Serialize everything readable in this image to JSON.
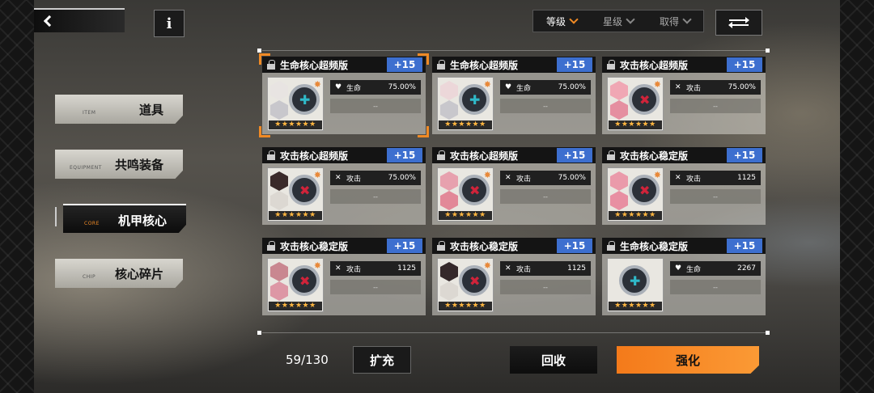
{
  "top": {
    "back_icon": "chevron-left-icon",
    "info_label": "i"
  },
  "sort": {
    "options": [
      {
        "label": "等级",
        "active": true
      },
      {
        "label": "星级",
        "active": false
      },
      {
        "label": "取得",
        "active": false
      }
    ],
    "swap_icon": "swap-arrows-icon"
  },
  "tabs": [
    {
      "en": "ITEM",
      "zh": "道具",
      "active": false
    },
    {
      "en": "EQUIPMENT",
      "zh": "共鸣装备",
      "active": false
    },
    {
      "en": "CORE",
      "zh": "机甲核心",
      "active": true
    },
    {
      "en": "CHIP",
      "zh": "核心碎片",
      "active": false
    }
  ],
  "cards": [
    {
      "name": "生命核心超频版",
      "level": "+15",
      "stat": "生命",
      "value": "75.00%",
      "empty": "--",
      "kind": "life",
      "selected": true,
      "stars": "★★★★★★",
      "hexes": [
        "#e8e4e2",
        "#c8c7cc"
      ]
    },
    {
      "name": "生命核心超频版",
      "level": "+15",
      "stat": "生命",
      "value": "75.00%",
      "empty": "--",
      "kind": "life",
      "selected": false,
      "stars": "★★★★★★",
      "hexes": [
        "#ecd7d9",
        "#c8c7cc"
      ]
    },
    {
      "name": "攻击核心超频版",
      "level": "+15",
      "stat": "攻击",
      "value": "75.00%",
      "empty": "--",
      "kind": "attack",
      "selected": false,
      "stars": "★★★★★★",
      "hexes": [
        "#f0a7b4",
        "#e58fa0"
      ]
    },
    {
      "name": "攻击核心超频版",
      "level": "+15",
      "stat": "攻击",
      "value": "75.00%",
      "empty": "--",
      "kind": "attack",
      "selected": false,
      "stars": "★★★★★★",
      "hexes": [
        "#3a2a2a",
        "#dcd8d2"
      ]
    },
    {
      "name": "攻击核心超频版",
      "level": "+15",
      "stat": "攻击",
      "value": "75.00%",
      "empty": "--",
      "kind": "attack",
      "selected": false,
      "stars": "★★★★★★",
      "hexes": [
        "#e7a1ae",
        "#e28898"
      ]
    },
    {
      "name": "攻击核心稳定版",
      "level": "+15",
      "stat": "攻击",
      "value": "1125",
      "empty": "--",
      "kind": "attack",
      "selected": false,
      "stars": "★★★★★★",
      "hexes": [
        "#ea9aaa",
        "#e88fa2"
      ]
    },
    {
      "name": "攻击核心稳定版",
      "level": "+15",
      "stat": "攻击",
      "value": "1125",
      "empty": "--",
      "kind": "attack",
      "selected": false,
      "stars": "★★★★★★",
      "hexes": [
        "#c98790",
        "#dd97a5"
      ]
    },
    {
      "name": "攻击核心稳定版",
      "level": "+15",
      "stat": "攻击",
      "value": "1125",
      "empty": "--",
      "kind": "attack",
      "selected": false,
      "stars": "★★★★★★",
      "hexes": [
        "#34282a",
        "#dcd8d2"
      ]
    },
    {
      "name": "生命核心稳定版",
      "level": "+15",
      "stat": "生命",
      "value": "2267",
      "empty": "--",
      "kind": "life",
      "selected": false,
      "stars": "★★★★★★",
      "hexes": []
    }
  ],
  "bottom": {
    "count": "59/130",
    "expand": "扩充",
    "recycle": "回收",
    "enhance": "强化"
  },
  "colors": {
    "accent": "#f08a25",
    "level_badge": "#3d6fcf",
    "life": "#2fb9c9",
    "attack": "#d0233a"
  }
}
